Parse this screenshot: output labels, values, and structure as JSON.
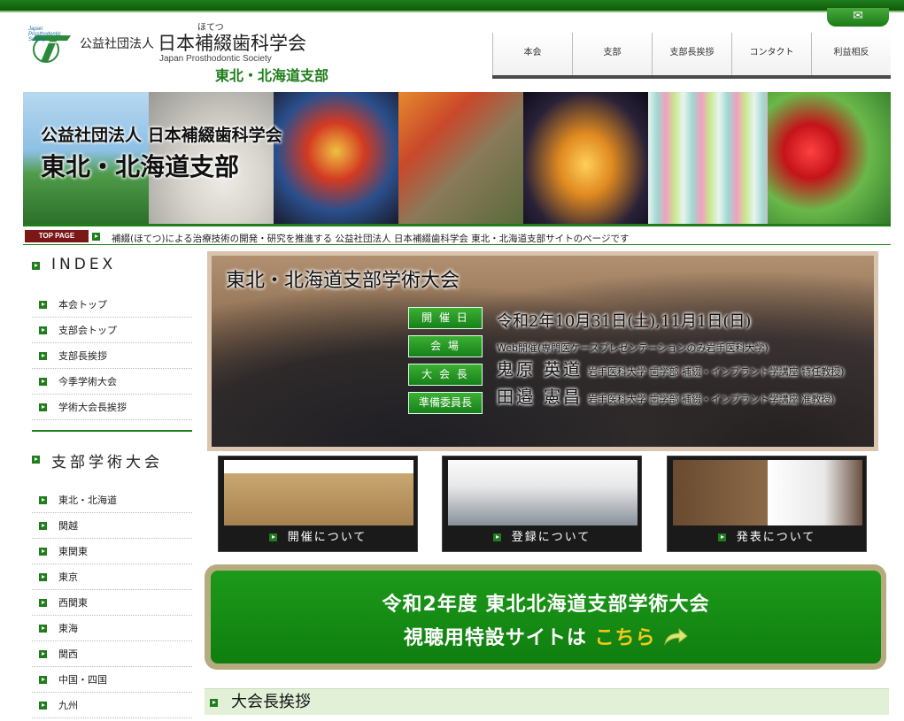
{
  "header": {
    "mail_icon": "mail-icon",
    "logo_text": "Japan Prosthodontic Society",
    "org_kind": "公益社団法人",
    "org_ruby": "ほてつ",
    "org_name": "日本補綴歯科学会",
    "org_en": "Japan Prosthodontic Society",
    "branch": "東北・北海道支部"
  },
  "nav": [
    {
      "label": "本会"
    },
    {
      "label": "支部"
    },
    {
      "label": "支部長挨拶"
    },
    {
      "label": "コンタクト"
    },
    {
      "label": "利益相反"
    }
  ],
  "banner": {
    "line1": "公益社団法人  日本補綴歯科学会",
    "line2": "東北・北海道支部"
  },
  "ticker": {
    "badge": "TOP PAGE",
    "text": "補綴(ほてつ)による治療技術の開発・研究を推進する 公益社団法人 日本補綴歯科学会  東北・北海道支部サイトのページです"
  },
  "sidebar": {
    "index_heading": "INDEX",
    "index_items": [
      {
        "label": "本会トップ"
      },
      {
        "label": "支部会トップ"
      },
      {
        "label": "支部長挨拶"
      },
      {
        "label": "今季学術大会"
      },
      {
        "label": "学術大会長挨拶"
      }
    ],
    "branch_heading": "支部学術大会",
    "branch_items": [
      {
        "label": "東北・北海道"
      },
      {
        "label": "関越"
      },
      {
        "label": "東関東"
      },
      {
        "label": "東京"
      },
      {
        "label": "西関東"
      },
      {
        "label": "東海"
      },
      {
        "label": "関西"
      },
      {
        "label": "中国・四国"
      },
      {
        "label": "九州"
      }
    ]
  },
  "hero": {
    "title": "東北・北海道支部学術大会",
    "labels": [
      "開 催 日",
      "会  場",
      "大 会 長",
      "準備委員長"
    ],
    "date": "令和2年10月31日(土),11月1日(日)",
    "venue": "Web開催(専門医ケースプレゼンテーションのみ岩手医科大学)",
    "president_name": "鬼原 英道",
    "president_affil": "岩手医科大学 歯学部 補綴・インプラント学講座 特任教授)",
    "chair_name": "田邉 憲昌",
    "chair_affil": "岩手医科大学 歯学部 補綴・インプラント学講座 准教授)"
  },
  "cards": [
    {
      "label": "開催について"
    },
    {
      "label": "登録について"
    },
    {
      "label": "発表について"
    }
  ],
  "cta": {
    "line1": "令和2年度  東北北海道支部学術大会",
    "line2_pre": "視聴用特設サイトは ",
    "line2_link": "こちら"
  },
  "section": {
    "title": "大会長挨拶"
  },
  "colors": {
    "brand_green": "#1f7d1b",
    "cta_green": "#169416",
    "link_yellow": "#f2c81a",
    "badge_red": "#7a1818"
  }
}
